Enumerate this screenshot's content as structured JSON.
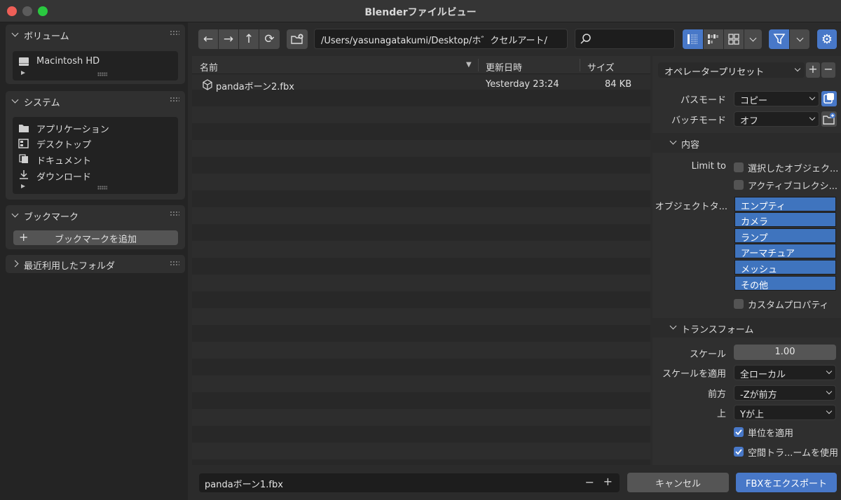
{
  "window": {
    "title": "Blenderファイルビュー"
  },
  "sidebar": {
    "volumes": {
      "label": "ボリューム",
      "items": [
        {
          "label": "Macintosh HD"
        }
      ]
    },
    "system": {
      "label": "システム",
      "items": [
        {
          "label": "アプリケーション"
        },
        {
          "label": "デスクトップ"
        },
        {
          "label": "ドキュメント"
        },
        {
          "label": "ダウンロード"
        }
      ]
    },
    "bookmarks": {
      "label": "ブックマーク",
      "add_label": "ブックマークを追加"
    },
    "recent": {
      "label": "最近利用したフォルダ"
    }
  },
  "toolbar": {
    "path": "/Users/yasunagatakumi/Desktop/ホ゛クセルアート/",
    "search_placeholder": ""
  },
  "file_list": {
    "headers": {
      "name": "名前",
      "date": "更新日時",
      "size": "サイズ"
    },
    "files": [
      {
        "name": "pandaボーン2.fbx",
        "date": "Yesterday 23:24",
        "size": "84 KB"
      }
    ]
  },
  "footer": {
    "filename": "pandaボーン1.fbx",
    "cancel_label": "キャンセル",
    "export_label": "FBXをエクスポート"
  },
  "options": {
    "preset_label": "オペレータープリセット",
    "path_mode": {
      "label": "パスモード",
      "value": "コピー"
    },
    "batch_mode": {
      "label": "バッチモード",
      "value": "オフ"
    },
    "include": {
      "label": "内容",
      "limit_to_label": "Limit to",
      "selected_objects": "選択したオブジェク...",
      "active_collection": "アクティブコレクシ...",
      "object_types_label": "オブジェクトタ...",
      "object_types": [
        "エンプティ",
        "カメラ",
        "ランプ",
        "アーマチュア",
        "メッシュ",
        "その他"
      ],
      "custom_properties": "カスタムプロパティ"
    },
    "transform": {
      "label": "トランスフォーム",
      "scale_label": "スケール",
      "scale_value": "1.00",
      "apply_scale_label": "スケールを適用",
      "apply_scale_value": "全ローカル",
      "forward_label": "前方",
      "forward_value": "-Zが前方",
      "up_label": "上",
      "up_value": "Yが上",
      "apply_unit": "単位を適用",
      "use_space_transform": "空間トラ...ームを使用"
    }
  },
  "colors": {
    "accent": "#4878c8",
    "close": "#ee5f57",
    "minimize": "#5b5b5b",
    "maximize": "#2ac940"
  }
}
